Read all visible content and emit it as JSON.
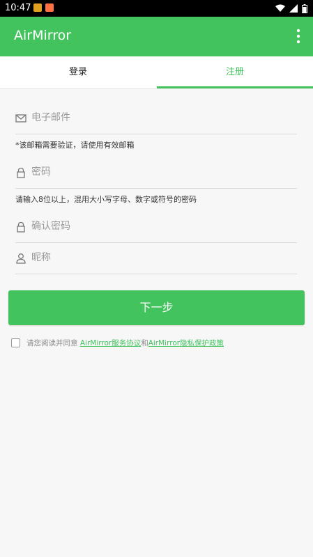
{
  "status_bar": {
    "time": "10:47",
    "icons": [
      "wifi-icon",
      "cellular-icon",
      "battery-icon"
    ],
    "notifications": [
      "app-notification-icon",
      "app-notification-icon"
    ]
  },
  "app_bar": {
    "title": "AirMirror",
    "color": "#43c35e",
    "menu_icon": "more-vertical-icon"
  },
  "tabs": [
    {
      "label": "登录",
      "active": false
    },
    {
      "label": "注册",
      "active": true
    }
  ],
  "form": {
    "email": {
      "placeholder": "电子邮件",
      "value": "",
      "icon": "mail-icon"
    },
    "email_hint": "*该邮箱需要验证，请使用有效邮箱",
    "password": {
      "placeholder": "密码",
      "value": "",
      "icon": "lock-icon"
    },
    "password_hint": "请输入8位以上，混用大小写字母、数字或符号的密码",
    "confirm_password": {
      "placeholder": "确认密码",
      "value": "",
      "icon": "lock-icon"
    },
    "nickname": {
      "placeholder": "昵称",
      "value": "",
      "icon": "user-icon"
    }
  },
  "next_button": {
    "label": "下一步"
  },
  "agreement": {
    "checked": false,
    "prefix": "请您阅读并同意",
    "terms_link": "AirMirror服务协议",
    "connector": "和",
    "privacy_link": "AirMirror隐私保护政策"
  },
  "accent_color": "#43c35e"
}
